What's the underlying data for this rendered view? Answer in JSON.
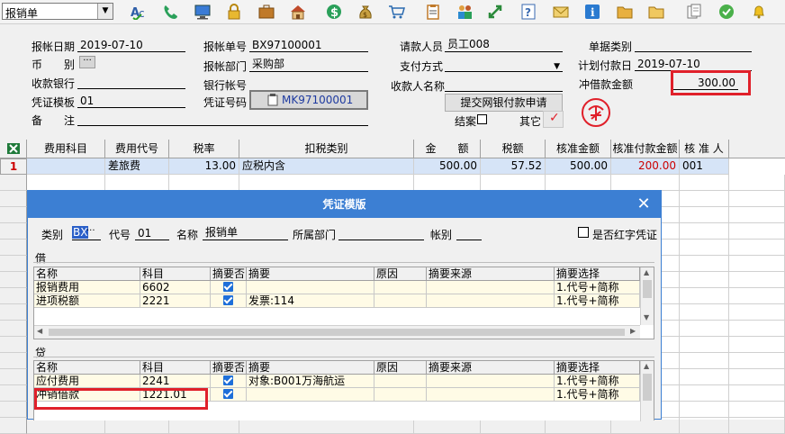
{
  "toolbar": {
    "type_select_value": "报销单",
    "icons": [
      "spell-check-icon",
      "phone-icon",
      "computer-icon",
      "lock-icon",
      "briefcase-icon",
      "home-icon",
      "dollar-icon",
      "money-bag-icon",
      "cart-icon",
      "clipboard-icon",
      "users-icon",
      "arrows-icon",
      "help-icon",
      "mail-icon",
      "info-icon",
      "folder-icon",
      "copy-icon",
      "ok-icon",
      "bell-icon"
    ]
  },
  "form": {
    "report_date_label": "报帐日期",
    "report_date": "2019-07-10",
    "report_no_label": "报帐单号",
    "report_no": "BX97100001",
    "applicant_label": "请款人员",
    "applicant": "员工008",
    "doc_type_label": "单据类别",
    "doc_type": "",
    "currency_label": "币　　别",
    "dept_label": "报帐部门",
    "dept": "采购部",
    "pay_method_label": "支付方式",
    "pay_method": "",
    "plan_pay_date_label": "计划付款日",
    "plan_pay_date": "2019-07-10",
    "bank_label": "收款银行",
    "bank_account_label": "银行帐号",
    "payee_name_label": "收款人名称",
    "offset_label": "冲借款金额",
    "offset_amount": "300.00",
    "template_label": "凭证模板",
    "template": "01",
    "voucher_no_label": "凭证号码",
    "voucher_no": "MK97100001",
    "submit_button": "提交网银付款申请",
    "note_label": "备　　注",
    "closed_label": "结案",
    "other_label": "其它"
  },
  "grid": {
    "headers": [
      "费用科目",
      "费用代号",
      "税率",
      "扣税类别",
      "金　　额",
      "税额",
      "核准金额",
      "核准付款金额",
      "核 准 人"
    ],
    "rows": [
      {
        "num": "1",
        "subject": "",
        "code": "差旅费",
        "rate": "13.00",
        "tax_type": "应税内含",
        "amount": "500.00",
        "tax": "57.52",
        "approved": "500.00",
        "approved_pay": "200.00",
        "approver": "001"
      }
    ]
  },
  "dialog": {
    "title": "凭证模版",
    "type_label": "类别",
    "type_value": "BX",
    "code_label": "代号",
    "code_value": "01",
    "name_label": "名称",
    "name_value": "报销单",
    "dept_label": "所属部门",
    "account_label": "帐别",
    "red_voucher_label": "是否红字凭证",
    "debit_label": "借",
    "credit_label": "贷",
    "columns": [
      "名称",
      "科目",
      "摘要否",
      "摘要",
      "原因",
      "摘要来源",
      "摘要选择"
    ],
    "debit_rows": [
      {
        "name": "报销费用",
        "subject": "6602",
        "summary": "",
        "choice": "1.代号+简称"
      },
      {
        "name": "进项税额",
        "subject": "2221",
        "summary": "发票:114",
        "choice": "1.代号+简称"
      }
    ],
    "credit_rows": [
      {
        "name": "应付费用",
        "subject": "2241",
        "summary": "对象:B001万海航运",
        "choice": "1.代号+简称"
      },
      {
        "name": "冲销借款",
        "subject": "1221.01",
        "summary": "",
        "choice": "1.代号+简称"
      }
    ]
  },
  "colors": {
    "accent": "#3c7fd3",
    "highlight": "#e0202a"
  }
}
